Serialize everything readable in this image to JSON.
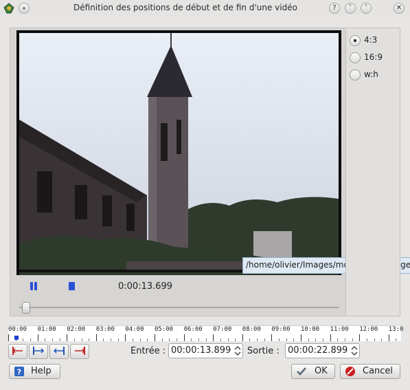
{
  "window": {
    "title": "Définition des positions de début et de fin d'une vidéo",
    "buttons": [
      "?",
      "˅",
      "˄",
      "✕"
    ]
  },
  "ratio_options": [
    {
      "label": "4:3",
      "checked": true
    },
    {
      "label": "16:9",
      "checked": false
    },
    {
      "label": "w:h",
      "checked": false
    }
  ],
  "video": {
    "tooltip": "/home/olivier/Images/montage_mariage",
    "current_time": "0:00:13.699",
    "seek_position_fraction": 0.02
  },
  "timeline": {
    "labels": [
      "00:00",
      "01:00",
      "02:00",
      "03:00",
      "04:00",
      "05:00",
      "06:00",
      "07:00",
      "08:00",
      "09:00",
      "10:00",
      "11:00",
      "12:00",
      "13:0"
    ]
  },
  "edit": {
    "entry_label": "Entrée :",
    "entry_value": "00:00:13.899",
    "exit_label": "Sortie :",
    "exit_value": "00:00:22.899"
  },
  "buttons": {
    "help": "Help",
    "ok": "OK",
    "cancel": "Cancel"
  },
  "colors": {
    "accent_blue": "#1a3fd0",
    "tooltip_bg": "#dfe9f4",
    "cancel_red": "#cc1f1f"
  }
}
